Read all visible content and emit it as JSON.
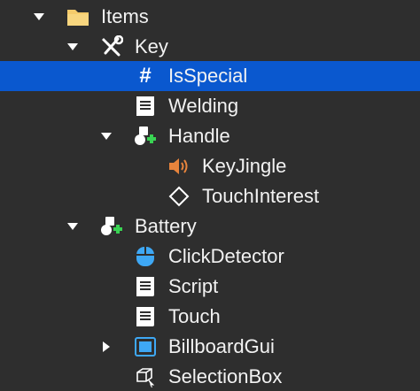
{
  "explorer": {
    "items": [
      {
        "label": "Items",
        "icon": "folder-icon",
        "expander": "expanded",
        "selected": false
      },
      {
        "label": "Key",
        "icon": "tools-icon",
        "expander": "expanded",
        "selected": false
      },
      {
        "label": "IsSpecial",
        "icon": "hash-icon",
        "expander": "none",
        "selected": true
      },
      {
        "label": "Welding",
        "icon": "script-icon",
        "expander": "none",
        "selected": false
      },
      {
        "label": "Handle",
        "icon": "part-add-icon",
        "expander": "expanded",
        "selected": false
      },
      {
        "label": "KeyJingle",
        "icon": "sound-icon",
        "expander": "none",
        "selected": false
      },
      {
        "label": "TouchInterest",
        "icon": "diamond-icon",
        "expander": "none",
        "selected": false
      },
      {
        "label": "Battery",
        "icon": "part-add-icon",
        "expander": "expanded",
        "selected": false
      },
      {
        "label": "ClickDetector",
        "icon": "mouse-icon",
        "expander": "none",
        "selected": false
      },
      {
        "label": "Script",
        "icon": "script-icon",
        "expander": "none",
        "selected": false
      },
      {
        "label": "Touch",
        "icon": "script-icon",
        "expander": "none",
        "selected": false
      },
      {
        "label": "BillboardGui",
        "icon": "billboard-icon",
        "expander": "collapsed",
        "selected": false
      },
      {
        "label": "SelectionBox",
        "icon": "selection-box-icon",
        "expander": "none",
        "selected": false
      }
    ],
    "hash_glyph": "#",
    "colors": {
      "background": "#2e2e2e",
      "selection": "#0a58cf",
      "folder": "#f5cb6b",
      "sound": "#e8843c",
      "mouse": "#3ea8f5",
      "billboard": "#3ea8f5",
      "add": "#39d353"
    }
  }
}
